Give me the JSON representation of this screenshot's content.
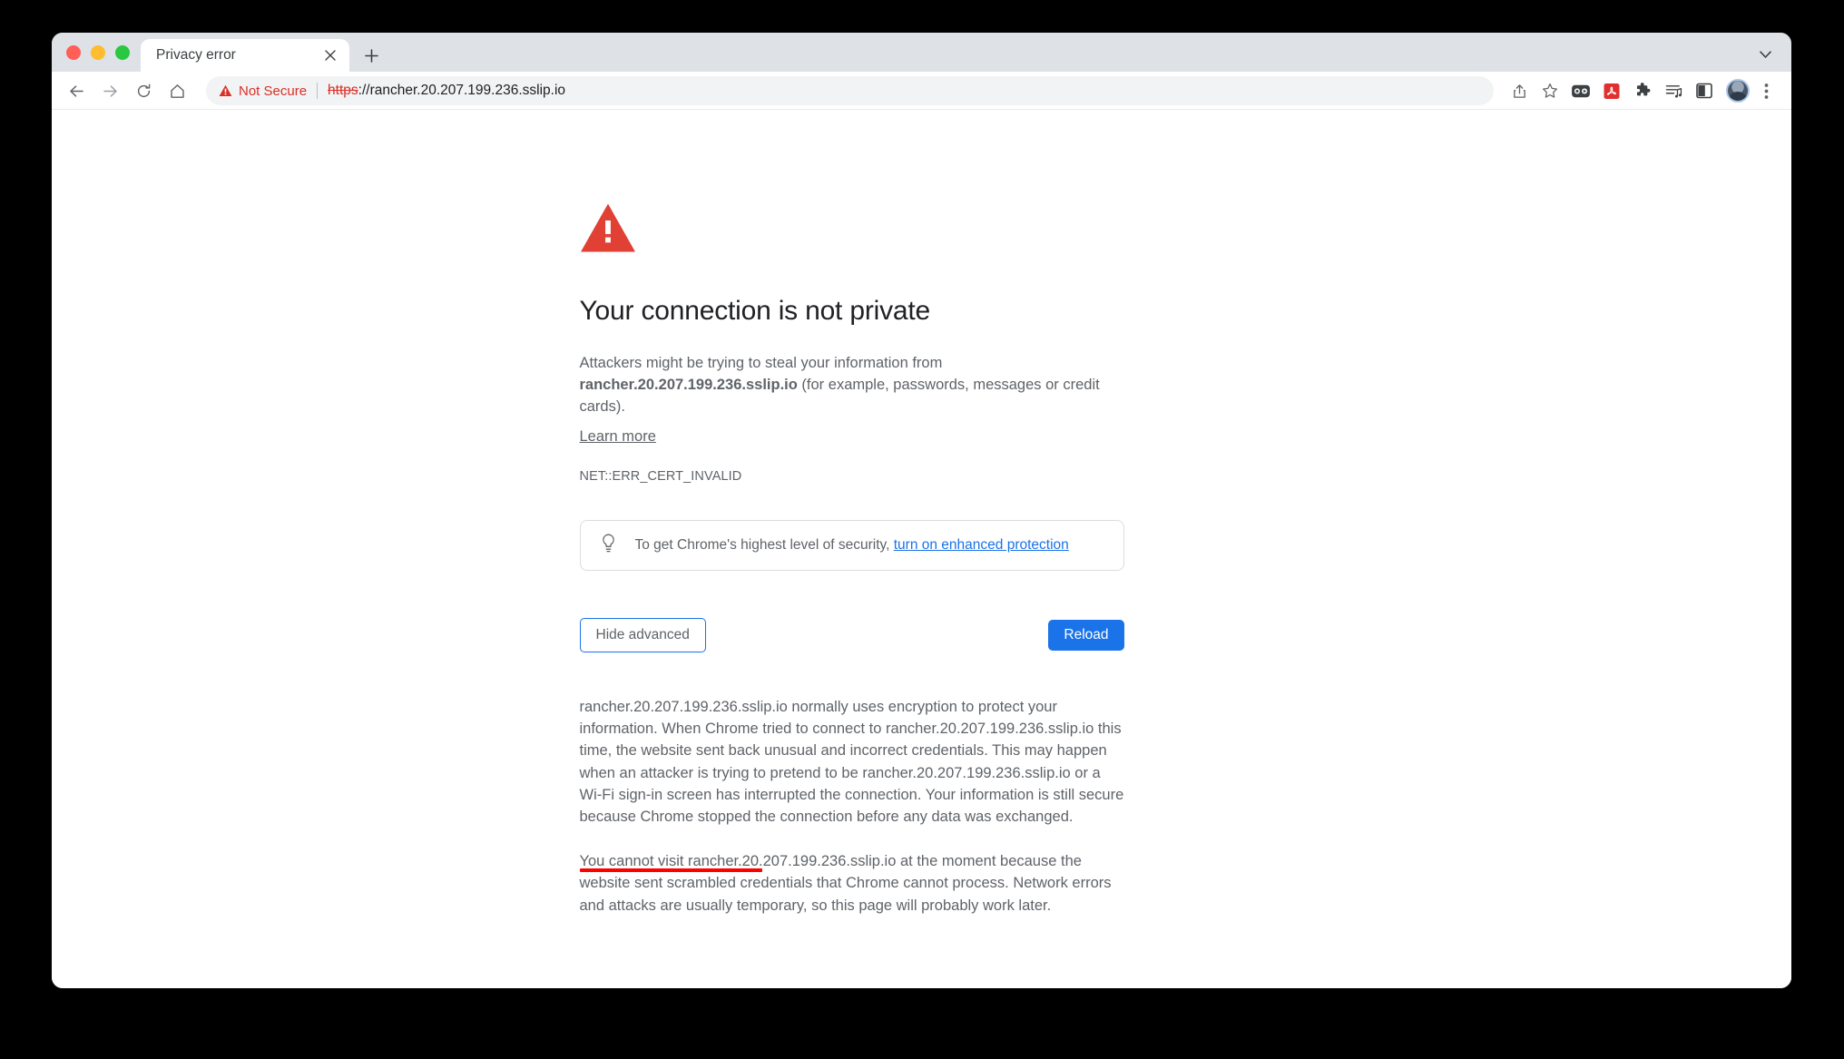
{
  "window": {
    "traffic_lights": [
      "close",
      "minimize",
      "maximize"
    ],
    "colors": {
      "close": "#ff5f57",
      "minimize": "#febc2e",
      "maximize": "#28c840",
      "tab_strip_bg": "#dee1e6",
      "accent_blue": "#1a73e8",
      "danger_red": "#d93025",
      "annotation_red": "#fe0000"
    }
  },
  "tabs": {
    "active": {
      "title": "Privacy error",
      "close_icon": "close-icon"
    },
    "new_tab_icon": "plus-icon",
    "tab_search_icon": "chevron-down-icon"
  },
  "toolbar": {
    "back_icon": "arrow-left-icon",
    "forward_icon": "arrow-right-icon",
    "reload_icon": "reload-icon",
    "home_icon": "home-icon",
    "omnibox": {
      "security_icon": "warning-triangle-icon",
      "security_label": "Not Secure",
      "url_scheme": "https",
      "url_rest": "://rancher.20.207.199.236.sslip.io",
      "url_full": "https://rancher.20.207.199.236.sslip.io"
    },
    "actions": [
      {
        "name": "share-icon"
      },
      {
        "name": "star-bookmark-icon"
      },
      {
        "name": "screen-capture-extension-icon"
      },
      {
        "name": "adobe-acrobat-extension-icon",
        "label": "A"
      },
      {
        "name": "puzzle-extensions-icon"
      },
      {
        "name": "reading-list-icon"
      },
      {
        "name": "side-panel-icon"
      },
      {
        "name": "profile-avatar"
      },
      {
        "name": "three-dot-menu-icon"
      }
    ]
  },
  "interstitial": {
    "icon": "red-warning-triangle-icon",
    "heading": "Your connection is not private",
    "summary_prefix": "Attackers might be trying to steal your information from",
    "host": "rancher.20.207.199.236.sslip.io",
    "summary_suffix": " (for example, passwords, messages or credit cards).",
    "learn_more_label": "Learn more",
    "error_code": "NET::ERR_CERT_INVALID",
    "enhanced_protection": {
      "icon": "lightbulb-icon",
      "text": "To get Chrome's highest level of security, ",
      "link_label": "turn on enhanced protection"
    },
    "buttons": {
      "hide_advanced_label": "Hide advanced",
      "reload_label": "Reload"
    },
    "advanced": {
      "paragraph_1": "rancher.20.207.199.236.sslip.io normally uses encryption to protect your information. When Chrome tried to connect to rancher.20.207.199.236.sslip.io this time, the website sent back unusual and incorrect credentials. This may happen when an attacker is trying to pretend to be rancher.20.207.199.236.sslip.io or a Wi-Fi sign-in screen has interrupted the connection. Your information is still secure because Chrome stopped the connection before any data was exchanged.",
      "paragraph_2": "You cannot visit rancher.20.207.199.236.sslip.io at the moment because the website sent scrambled credentials that Chrome cannot process. Network errors and attacks are usually temporary, so this page will probably work later."
    }
  }
}
